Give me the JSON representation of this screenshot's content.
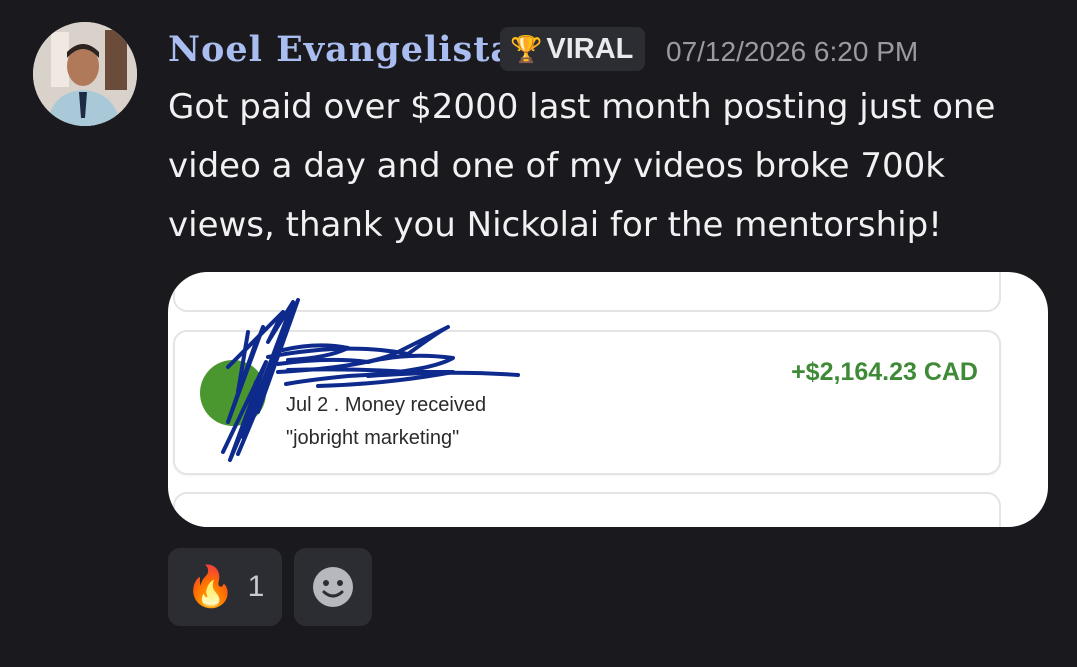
{
  "message": {
    "username": "Noel Evangelista",
    "badge": {
      "icon": "trophy-icon",
      "label": "VIRAL"
    },
    "timestamp": "07/12/2026 6:20 PM",
    "text": "Got paid over $2000 last month posting just one video a day and one of my videos broke 700k views, thank you Nickolai for the mentorship!"
  },
  "attachment": {
    "transaction": {
      "amount": "+$2,164.23 CAD",
      "date_type": "Jul 2 . Money received",
      "note": "\"jobright marketing\""
    },
    "colors": {
      "amount": "#3f8a36",
      "circle": "#4a962f",
      "scribble": "#0d2a8c"
    }
  },
  "reactions": [
    {
      "emoji": "🔥",
      "icon": "fire-icon",
      "count": "1"
    }
  ],
  "add_reaction": {
    "icon": "smiley-add-reaction-icon"
  },
  "colors": {
    "background": "#1a1a1e",
    "username": "#a9bdf0",
    "text": "#f1f1f3",
    "timestamp": "#9a9ba1"
  }
}
